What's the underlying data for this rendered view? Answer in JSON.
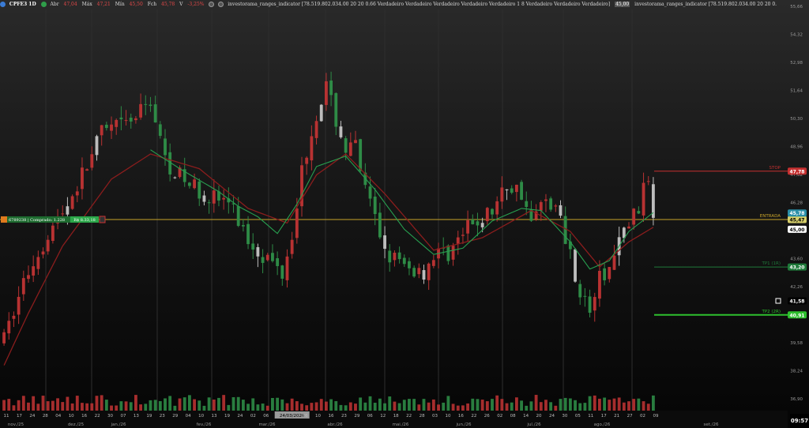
{
  "header": {
    "symbol": "CPFE3 1D",
    "abr_label": "Abr",
    "abr_value": "47,04",
    "max_label": "Máx",
    "max_value": "47,21",
    "min_label": "Mín",
    "min_value": "45,50",
    "fch_label": "Fch",
    "fch_value": "45,78",
    "var_label": "V",
    "var_value": "-3,25%",
    "indicator_text": "investorama_ranges_indicator [78.519.802.034.00 20 20 0.66 Verdadeiro Verdadeiro Verdadeiro Verdadeiro Verdadeiro 1 8 Verdadeiro Verdadeiro Verdadeiro]",
    "indicator_value": "45,00",
    "indicator_text2": "investorama_ranges_indicator [78.519.802.034.00 20 20 0."
  },
  "position_tag": {
    "left": "6789238 | Comprado: 1.228",
    "right": "R$ 8.33,18"
  },
  "clock": "09:57",
  "colors": {
    "bull": "#b83232",
    "bear": "#2e8b46",
    "neutral": "#bdbdbd",
    "stop": "#c53030",
    "entry": "#c8a42a",
    "tp1": "#1f7a3a",
    "tp2": "#2ec02e",
    "ma_slow": "#8b1d1d",
    "ma_fast": "#27a050"
  },
  "chart_data": {
    "type": "candlestick",
    "symbol": "CPFE3",
    "timeframe": "1D",
    "y_axis": {
      "min": 36.9,
      "max": 55.66,
      "ticks": [
        55.66,
        54.32,
        52.98,
        51.64,
        50.3,
        48.96,
        47.62,
        46.28,
        44.94,
        43.6,
        42.26,
        40.92,
        39.58,
        38.24,
        36.9
      ]
    },
    "x_axis": {
      "day_ticks": [
        "11",
        "17",
        "24",
        "28",
        "04",
        "10",
        "16",
        "22",
        "30",
        "07",
        "13",
        "19",
        "23",
        "29",
        "04",
        "10",
        "13",
        "19",
        "24",
        "02",
        "06",
        "12",
        "24/03/2026",
        "06",
        "10",
        "16",
        "23",
        "29",
        "06",
        "12",
        "18",
        "22",
        "28",
        "03",
        "10",
        "16",
        "22",
        "26",
        "02",
        "08",
        "14",
        "20",
        "24",
        "30",
        "05",
        "11",
        "17",
        "21",
        "27",
        "02",
        "09"
      ],
      "month_labels": [
        "nov./25",
        "dez./25",
        "jan./26",
        "fev./26",
        "mar./26",
        "abr./26",
        "mai./26",
        "jun./26",
        "jul./26",
        "ago./26",
        "set./26"
      ],
      "highlighted_tick": "24/03/2026"
    },
    "levels": [
      {
        "name": "STOP",
        "label": "STOP",
        "value": 47.78,
        "tag": "47,78"
      },
      {
        "name": "ENTRADA",
        "label": "ENTRADA",
        "value": 45.47,
        "tag": "45,47"
      },
      {
        "name": "TP1",
        "label": "TP1 (1R)",
        "value": 43.2,
        "tag": "43,20"
      },
      {
        "name": "TP2",
        "label": "TP2 (2R)",
        "value": 40.91,
        "tag": "40,91"
      }
    ],
    "price_tags": [
      {
        "value": 45.78,
        "text": "45,78",
        "kind": "last"
      },
      {
        "value": 45.0,
        "text": "45,00",
        "kind": "indicator"
      },
      {
        "value": 41.58,
        "text": "41,58",
        "kind": "crosshair"
      }
    ],
    "anchors": [
      [
        0,
        39.7
      ],
      [
        4,
        42.5
      ],
      [
        9,
        44.8
      ],
      [
        13,
        46.2
      ],
      [
        16,
        47.6
      ],
      [
        20,
        49.6
      ],
      [
        26,
        50.1
      ],
      [
        30,
        51.2
      ],
      [
        33,
        48.3
      ],
      [
        37,
        47.3
      ],
      [
        41,
        46.7
      ],
      [
        46,
        46.3
      ],
      [
        50,
        44.5
      ],
      [
        54,
        43.6
      ],
      [
        57,
        43.0
      ],
      [
        59,
        44.9
      ],
      [
        61,
        47.8
      ],
      [
        64,
        50.6
      ],
      [
        66,
        51.8
      ],
      [
        68,
        50.2
      ],
      [
        70,
        48.8
      ],
      [
        72,
        48.9
      ],
      [
        74,
        46.8
      ],
      [
        78,
        44.1
      ],
      [
        82,
        43.1
      ],
      [
        86,
        43.0
      ],
      [
        88,
        43.8
      ],
      [
        91,
        43.9
      ],
      [
        95,
        45.0
      ],
      [
        100,
        45.9
      ],
      [
        103,
        47.1
      ],
      [
        106,
        46.8
      ],
      [
        108,
        45.3
      ],
      [
        111,
        46.5
      ],
      [
        113,
        46.1
      ],
      [
        116,
        43.9
      ],
      [
        118,
        42.0
      ],
      [
        120,
        41.1
      ],
      [
        122,
        42.6
      ],
      [
        124,
        43.1
      ],
      [
        127,
        44.9
      ],
      [
        130,
        46.1
      ],
      [
        132,
        47.5
      ],
      [
        133,
        45.8
      ]
    ],
    "ma_slow_anchors": [
      [
        0,
        38.5
      ],
      [
        5,
        41.0
      ],
      [
        12,
        44.2
      ],
      [
        22,
        47.4
      ],
      [
        30,
        48.6
      ],
      [
        40,
        47.9
      ],
      [
        50,
        46.0
      ],
      [
        58,
        45.3
      ],
      [
        64,
        47.6
      ],
      [
        70,
        48.6
      ],
      [
        78,
        46.7
      ],
      [
        88,
        44.0
      ],
      [
        98,
        44.6
      ],
      [
        108,
        45.9
      ],
      [
        116,
        44.9
      ],
      [
        122,
        43.2
      ],
      [
        128,
        44.4
      ],
      [
        133,
        45.1
      ]
    ],
    "ma_fast_anchors": [
      [
        30,
        48.8
      ],
      [
        36,
        47.9
      ],
      [
        44,
        46.8
      ],
      [
        48,
        46.1
      ],
      [
        52,
        45.6
      ],
      [
        56,
        44.8
      ],
      [
        60,
        46.2
      ],
      [
        64,
        48.0
      ],
      [
        70,
        48.5
      ],
      [
        76,
        46.9
      ],
      [
        82,
        45.0
      ],
      [
        88,
        43.8
      ],
      [
        94,
        44.1
      ],
      [
        100,
        45.4
      ],
      [
        106,
        46.0
      ],
      [
        110,
        45.9
      ],
      [
        116,
        44.4
      ],
      [
        120,
        43.1
      ],
      [
        124,
        43.5
      ],
      [
        128,
        44.9
      ],
      [
        133,
        45.8
      ]
    ],
    "candle_count": 134,
    "volume": {
      "panel": "bars",
      "bull_color": "#b83232",
      "bear_color": "#2e8b46"
    }
  }
}
